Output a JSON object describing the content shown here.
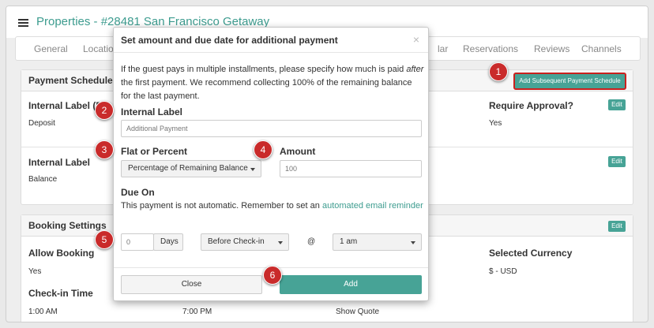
{
  "header": {
    "title": "Properties - #28481 San Francisco Getaway"
  },
  "tabs": [
    "General",
    "Location",
    "lar",
    "Reservations",
    "Reviews",
    "Channels"
  ],
  "payment_schedule": {
    "title": "Payment Schedule",
    "add_button": "Add Subsequent Payment Schedule",
    "rows": [
      {
        "label": "Internal Label (F",
        "value": "Deposit"
      },
      {
        "label": "Internal Label",
        "value": "Balance"
      }
    ],
    "require_approval": {
      "label": "Require Approval?",
      "value": "Yes"
    },
    "edit_label": "Edit"
  },
  "booking_settings": {
    "title": "Booking Settings",
    "allow_booking": {
      "label": "Allow Booking",
      "value": "Yes"
    },
    "selected_currency": {
      "label": "Selected Currency",
      "value": "$ - USD"
    },
    "checkin_time": {
      "label": "Check-in Time",
      "value": "1:00 AM"
    },
    "col2_value": "7:00 PM",
    "col3_value": "Show Quote"
  },
  "modal": {
    "title": "Set amount and due date for additional payment",
    "close_glyph": "×",
    "intro_1": "If the guest pays in multiple installments, please specify how much is paid",
    "intro_after": "after",
    "intro_2": " the first payment. We recommend collecting 100% of the remaining balance for the last payment.",
    "internal_label": {
      "label": "Internal Label",
      "placeholder": "Additional Payment"
    },
    "flat_or_percent": {
      "label": "Flat or Percent",
      "selected": "Percentage of Remaining Balance"
    },
    "amount": {
      "label": "Amount",
      "placeholder": "100"
    },
    "due_on": {
      "label": "Due On",
      "note": "This payment is not automatic. Remember to set an ",
      "note_link": "automated email reminder",
      "days_value": "0",
      "days_unit": "Days",
      "when": "Before Check-in",
      "at": "@",
      "time": "1 am"
    },
    "close_button": "Close",
    "add_button": "Add"
  },
  "callouts": [
    "1",
    "2",
    "3",
    "4",
    "5",
    "6"
  ],
  "colors": {
    "accent": "#47a396",
    "callout": "#c92b2b",
    "title_link": "#3d9c8f"
  }
}
